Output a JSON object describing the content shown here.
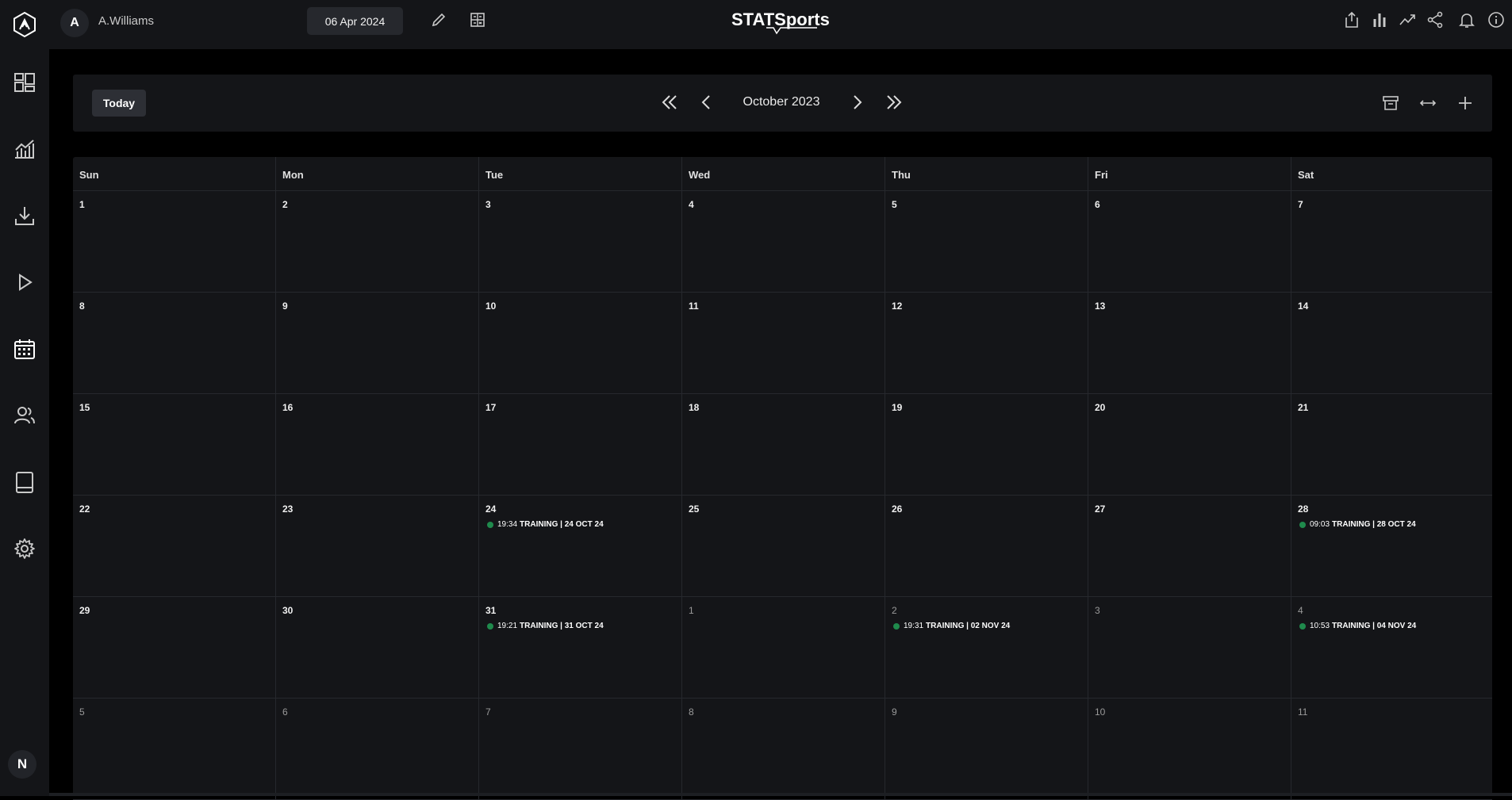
{
  "user": {
    "initial": "A",
    "name": "A.Williams"
  },
  "topbar": {
    "date": "06 Apr 2024",
    "brand": "STATSports"
  },
  "sidebar": {
    "items": [
      {
        "name": "dashboard-icon"
      },
      {
        "name": "analytics-icon"
      },
      {
        "name": "download-icon"
      },
      {
        "name": "play-icon"
      },
      {
        "name": "calendar-icon"
      },
      {
        "name": "users-icon"
      },
      {
        "name": "tablet-icon"
      },
      {
        "name": "settings-icon"
      }
    ],
    "bottom_initial": "N"
  },
  "calendar": {
    "today_label": "Today",
    "month_label": "October 2023",
    "weekdays": [
      "Sun",
      "Mon",
      "Tue",
      "Wed",
      "Thu",
      "Fri",
      "Sat"
    ],
    "weeks": [
      [
        {
          "day": "1"
        },
        {
          "day": "2"
        },
        {
          "day": "3"
        },
        {
          "day": "4"
        },
        {
          "day": "5"
        },
        {
          "day": "6"
        },
        {
          "day": "7"
        }
      ],
      [
        {
          "day": "8"
        },
        {
          "day": "9"
        },
        {
          "day": "10"
        },
        {
          "day": "11"
        },
        {
          "day": "12"
        },
        {
          "day": "13"
        },
        {
          "day": "14"
        }
      ],
      [
        {
          "day": "15"
        },
        {
          "day": "16"
        },
        {
          "day": "17"
        },
        {
          "day": "18"
        },
        {
          "day": "19"
        },
        {
          "day": "20"
        },
        {
          "day": "21"
        }
      ],
      [
        {
          "day": "22"
        },
        {
          "day": "23"
        },
        {
          "day": "24",
          "event": {
            "time": "19:34",
            "title": "TRAINING | 24 OCT 24"
          }
        },
        {
          "day": "25"
        },
        {
          "day": "26"
        },
        {
          "day": "27"
        },
        {
          "day": "28",
          "event": {
            "time": "09:03",
            "title": "TRAINING | 28 OCT 24"
          }
        }
      ],
      [
        {
          "day": "29"
        },
        {
          "day": "30"
        },
        {
          "day": "31",
          "event": {
            "time": "19:21",
            "title": "TRAINING | 31 OCT 24"
          }
        },
        {
          "day": "1",
          "other": true
        },
        {
          "day": "2",
          "other": true,
          "event": {
            "time": "19:31",
            "title": "TRAINING | 02 NOV 24"
          }
        },
        {
          "day": "3",
          "other": true
        },
        {
          "day": "4",
          "other": true,
          "event": {
            "time": "10:53",
            "title": "TRAINING | 04 NOV 24"
          }
        }
      ],
      [
        {
          "day": "5",
          "other": true
        },
        {
          "day": "6",
          "other": true
        },
        {
          "day": "7",
          "other": true
        },
        {
          "day": "8",
          "other": true
        },
        {
          "day": "9",
          "other": true
        },
        {
          "day": "10",
          "other": true
        },
        {
          "day": "11",
          "other": true
        }
      ]
    ]
  },
  "colors": {
    "event_dot": "#1f8a4c",
    "panel": "#141518",
    "background": "#000000"
  }
}
